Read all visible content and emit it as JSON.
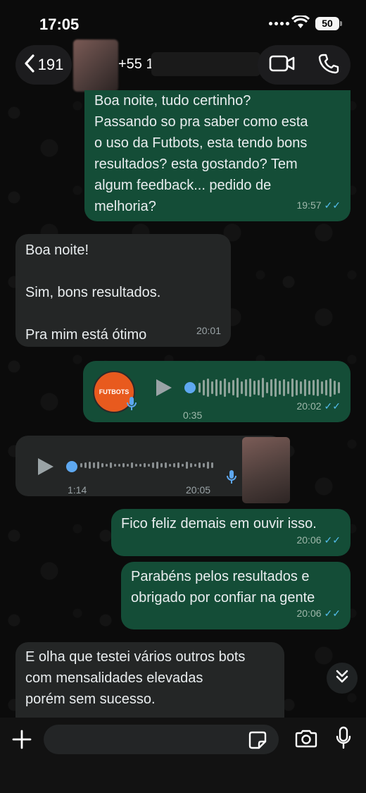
{
  "status": {
    "time": "17:05",
    "battery": "50"
  },
  "header": {
    "back_count": "191",
    "contact_name": "+55 1"
  },
  "messages": [
    {
      "text": "Boa noite, tudo certinho?\nPassando so pra saber como esta\no uso da Futbots, esta tendo bons\nresultados? esta gostando? Tem\nalgum feedback... pedido de\nmelhoria?",
      "time": "19:57"
    },
    {
      "text": "Boa noite!\n\nSim, bons resultados.\n\nPra mim está ótimo",
      "time": "20:01"
    },
    {
      "audio_duration": "0:35",
      "time": "20:02",
      "avatar_label": "FUTBOTS"
    },
    {
      "audio_duration": "1:14",
      "time": "20:05"
    },
    {
      "text": "Fico feliz demais em ouvir isso.",
      "time": "20:06"
    },
    {
      "text": "Parabéns pelos resultados e\nobrigado por confiar na gente",
      "time": "20:06"
    },
    {
      "text": "E olha que testei vários outros bots\ncom mensalidades elevadas\nporém sem sucesso."
    }
  ],
  "icons": {
    "back": "chevron-left-icon",
    "video": "video-camera-icon",
    "call": "phone-icon",
    "plus": "plus-icon",
    "sticker": "sticker-icon",
    "camera": "camera-icon",
    "mic": "microphone-icon",
    "scroll": "double-chevron-down-icon"
  },
  "colors": {
    "outgoing": "#144d37",
    "incoming": "#242626",
    "read_ticks": "#53bdeb",
    "audio_dot": "#5ea8f0"
  }
}
